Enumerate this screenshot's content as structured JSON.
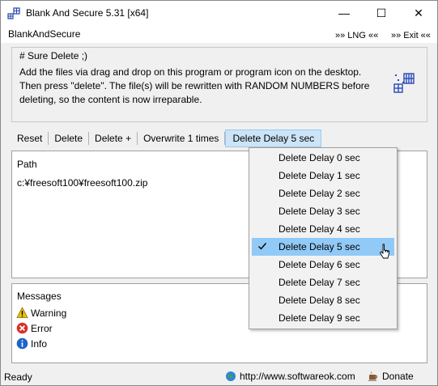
{
  "window": {
    "title": "Blank And Secure 5.31 [x64]",
    "minimize_glyph": "—",
    "maximize_glyph": "☐",
    "close_glyph": "✕"
  },
  "menubar": {
    "brand": "BlankAndSecure",
    "lng": "»» LNG ««",
    "exit": "»» Exit ««"
  },
  "info": {
    "legend": "# Sure Delete ;)",
    "line1": "Add the files via drag and drop on this program or program icon on the desktop.",
    "line2": "Then press \"delete\". The file(s) will be rewritten with RANDOM NUMBERS before",
    "line3": "deleting, so the content is now irreparable."
  },
  "toolbar": {
    "buttons": [
      "Reset",
      "Delete",
      "Delete +",
      "Overwrite 1 times",
      "Delete Delay 5 sec"
    ],
    "active_index": 4
  },
  "path_pane": {
    "header": "Path",
    "rows": [
      "c:¥freesoft100¥freesoft100.zip"
    ]
  },
  "messages": {
    "header": "Messages",
    "items": [
      {
        "label": "Warning",
        "icon": "warning-icon",
        "color": "#f0c000"
      },
      {
        "label": "Error",
        "icon": "error-icon",
        "color": "#d93025"
      },
      {
        "label": "Info",
        "icon": "info-icon",
        "color": "#1e64c8"
      }
    ]
  },
  "dropdown": {
    "items": [
      "Delete Delay 0 sec",
      "Delete Delay 1 sec",
      "Delete Delay 2 sec",
      "Delete Delay 3 sec",
      "Delete Delay 4 sec",
      "Delete Delay 5 sec",
      "Delete Delay 6 sec",
      "Delete Delay 7 sec",
      "Delete Delay 8 sec",
      "Delete Delay 9 sec"
    ],
    "checked_index": 5
  },
  "status": {
    "ready": "Ready",
    "url": "http://www.softwareok.com",
    "donate": "Donate"
  },
  "colors": {
    "highlight": "#91c9f7",
    "active_button": "#cce4f7"
  }
}
